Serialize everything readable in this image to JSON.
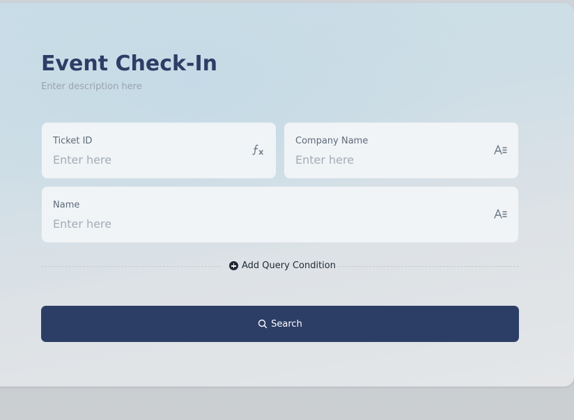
{
  "form": {
    "title": "Event Check-In",
    "description": "Enter description here",
    "fields": [
      {
        "label": "Ticket ID",
        "placeholder": "Enter here",
        "icon": "function-icon"
      },
      {
        "label": "Company Name",
        "placeholder": "Enter here",
        "icon": "text-format-icon"
      },
      {
        "label": "Name",
        "placeholder": "Enter here",
        "icon": "text-format-icon"
      }
    ],
    "add_condition_label": "Add Query Condition",
    "search_label": "Search"
  },
  "colors": {
    "primary": "#2d3e66",
    "title": "#2c3e66",
    "field_bg": "#f0f4f7"
  }
}
